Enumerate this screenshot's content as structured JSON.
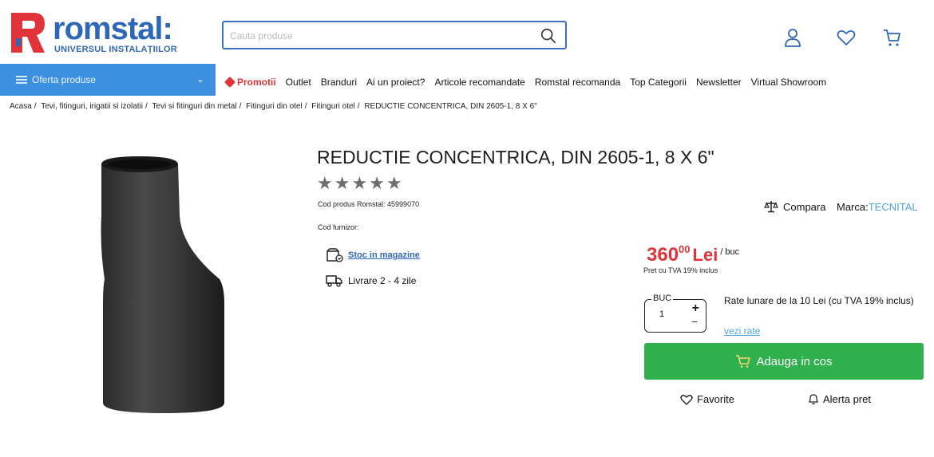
{
  "brand": {
    "name": "romstal:",
    "tagline": "UNIVERSUL INSTALAȚIILOR",
    "primary_color": "#2f67b8",
    "accent_color": "#e0343a"
  },
  "search": {
    "placeholder": "Cauta produse"
  },
  "header_icons": [
    "user-icon",
    "heart-icon",
    "cart-icon"
  ],
  "menu_button": {
    "label": "Oferta produse"
  },
  "nav": {
    "items": [
      "Promotii",
      "Outlet",
      "Branduri",
      "Ai un proiect?",
      "Articole recomandate",
      "Romstal recomanda",
      "Top Categorii",
      "Newsletter",
      "Virtual Showroom"
    ]
  },
  "breadcrumbs": [
    "Acasa",
    "Tevi, fitinguri, irigatii si izolatii",
    "Tevi si fitinguri din metal",
    "Fitinguri din otel",
    "Fitinguri otel",
    "REDUCTIE CONCENTRICA, DIN 2605-1, 8 X 6\""
  ],
  "product": {
    "title": "REDUCTIE CONCENTRICA, DIN 2605-1, 8 X 6\"",
    "rating": 0,
    "rating_max": 5,
    "code_label": "Cod produs Romstal: 45999070",
    "supplier_label": "Cod furnizor:",
    "stock_link": "Stoc in magazine",
    "delivery": "Livrare 2 - 4 zile",
    "compare_label": "Compara",
    "brand_label": "Marca:",
    "brand_value": "TECNITAL"
  },
  "price": {
    "integer": "360",
    "decimals": "00",
    "currency": "Lei",
    "unit": "/ buc",
    "vat_note": "Pret cu TVA 19% inclus"
  },
  "quantity": {
    "label": "BUC",
    "value": "1",
    "plus": "+",
    "minus": "−"
  },
  "installments": {
    "text": "Rate lunare de la 10 Lei (cu TVA 19% inclus)",
    "link": "vezi rate"
  },
  "actions": {
    "add_to_cart": "Adauga in cos",
    "favorite": "Favorite",
    "price_alert": "Alerta pret"
  }
}
